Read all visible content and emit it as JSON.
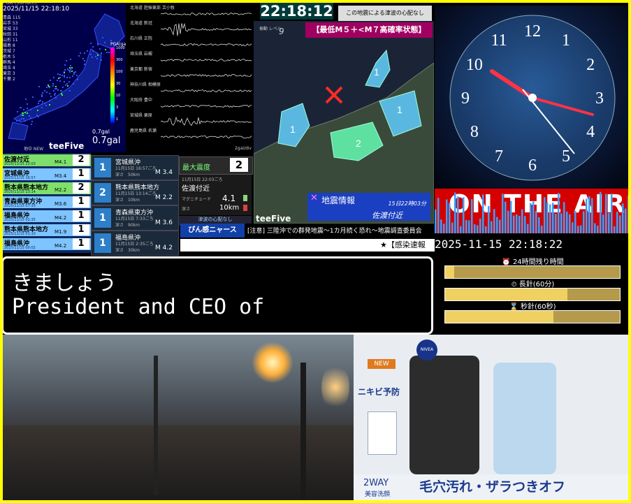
{
  "seismic_map": {
    "source": "PGA (Surface)",
    "timestamp": "2025/11/15 22:18:10",
    "prefectures": [
      "青森 115",
      "岩手 53",
      "宮城 33",
      "秋田 31",
      "山形 11",
      "福島 8",
      "茨城 7",
      "栃木 5",
      "群馬 4",
      "埼玉 4",
      "東京 3",
      "千葉 2"
    ],
    "scale_title": "PGA(gal)",
    "scale_ticks": [
      "1000",
      "300",
      "100",
      "30",
      "10",
      "3",
      "1"
    ],
    "gal_small": "0.7gal",
    "gal": "0.7gal",
    "new_label": "地中 NEW",
    "logo": "teeFive"
  },
  "waveform": {
    "stations": [
      "北海道 胆振東部 苫小牧",
      "北海道 新冠",
      "石川県 正院",
      "埼玉県 岩槻",
      "東京都 新宿",
      "神奈川県 相模原",
      "大阪府 豊中",
      "宮城県 栗原",
      "鹿児島県 名瀬"
    ],
    "unit": "2gal/div"
  },
  "quake_list": [
    {
      "name": "佐渡付近",
      "date": "2025/11/15 22:03",
      "mag": "M4.1",
      "int": "2",
      "color": "#7ee06a"
    },
    {
      "name": "宮城県沖",
      "date": "2025/11/15 16:57",
      "mag": "M3.4",
      "int": "1",
      "color": "#7ec4ff"
    },
    {
      "name": "熊本県熊本地方",
      "date": "2025/11/15 13:14",
      "mag": "M2.2",
      "int": "2",
      "color": "#7ee06a"
    },
    {
      "name": "青森県東方沖",
      "date": "2025/11/15 07:33",
      "mag": "M3.6",
      "int": "1",
      "color": "#7ec4ff"
    },
    {
      "name": "福島県沖",
      "date": "2025/11/15 02:35",
      "mag": "M4.2",
      "int": "1",
      "color": "#7ec4ff"
    },
    {
      "name": "熊本県熊本地方",
      "date": "2025/11/15 01:10",
      "mag": "M1.9",
      "int": "1",
      "color": "#7ec4ff"
    },
    {
      "name": "福島県沖",
      "date": "2025/11/15 00:02",
      "mag": "M4.2",
      "int": "1",
      "color": "#7ec4ff"
    }
  ],
  "cards": [
    {
      "badge": "1",
      "name": "宮城県沖",
      "date": "11月15日 16:57ごろ",
      "depth": "深さ　50km",
      "mag": "M 3.4"
    },
    {
      "badge": "2",
      "name": "熊本県熊本地方",
      "date": "11月15日 13:14ごろ",
      "depth": "深さ　10km",
      "mag": "M 2.2"
    },
    {
      "badge": "1",
      "name": "青森県東方沖",
      "date": "11月15日 7:33ごろ",
      "depth": "深さ　90km",
      "mag": "M 3.6"
    },
    {
      "badge": "1",
      "name": "福島県沖",
      "date": "11月15日 2:35ごろ",
      "depth": "深さ　30km",
      "mag": "M 4.2"
    }
  ],
  "max_intensity": {
    "label": "最大震度",
    "value": "2"
  },
  "detail": {
    "date": "11月15日 22:03ごろ",
    "place": "佐渡付近",
    "mag_label": "マグニチュード",
    "mag": "4.1",
    "depth_label": "深さ",
    "depth": "10km",
    "tsunami": "津波の心配なし"
  },
  "center": {
    "clock": "22:18:12",
    "warning": "この地震による津波の心配なし",
    "level_label": "振動 レベル",
    "level": "9",
    "probability": "【最低M５＋<M７高確率状態】",
    "eq_title": "地震情報",
    "eq_time": "15日22時03分",
    "eq_place": "佐渡付近",
    "logo": "teeFive",
    "region_labels": [
      "1",
      "1",
      "2",
      "1"
    ]
  },
  "ticker": {
    "tag": "ぴん感ニャース",
    "text": "[注意] 三陸沖での群発地震～1カ月続く恐れ～地震調査委員会",
    "breaking": "★【感染速報"
  },
  "subtitle": {
    "line1": "きましょう",
    "line2": "President and CEO of"
  },
  "right": {
    "clock_numbers": [
      "12",
      "1",
      "2",
      "3",
      "4",
      "5",
      "6",
      "7",
      "8",
      "9",
      "10",
      "11"
    ],
    "on_air": "ON THE AIR",
    "datetime": "2025-11-15 22:18:22",
    "bars": [
      {
        "title": "⏰ 24時間残り時間",
        "fill": 0.05
      },
      {
        "title": "⏲ 長針(60分)",
        "fill": 0.7
      },
      {
        "title": "⌛ 秒針(60秒)",
        "fill": 0.62
      }
    ]
  },
  "ad": {
    "new": "NEW",
    "brand": "NIVEA",
    "product": "ニキビ予防",
    "way": "2WAY",
    "way_sub": "美容洗顔",
    "caption": "毛穴汚れ・ザラつきオフ"
  }
}
